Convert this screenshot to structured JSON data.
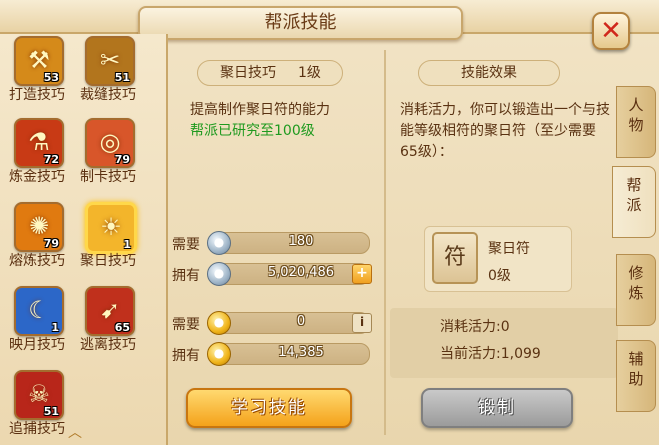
{
  "window": {
    "title": "帮派技能"
  },
  "skills": [
    {
      "name": "打造技巧",
      "level": "53",
      "color": "#d58a1a",
      "glyph": "⚒"
    },
    {
      "name": "裁缝技巧",
      "level": "51",
      "color": "#b2751d",
      "glyph": "✂"
    },
    {
      "name": "炼金技巧",
      "level": "72",
      "color": "#c83a15",
      "glyph": "⚗"
    },
    {
      "name": "制卡技巧",
      "level": "79",
      "color": "#d8562a",
      "glyph": "◎"
    },
    {
      "name": "熔炼技巧",
      "level": "79",
      "color": "#e07a10",
      "glyph": "✺"
    },
    {
      "name": "聚日技巧",
      "level": "1",
      "color": "#f3b52b",
      "glyph": "☀",
      "selected": true
    },
    {
      "name": "映月技巧",
      "level": "1",
      "color": "#2c67c8",
      "glyph": "☾"
    },
    {
      "name": "逃离技巧",
      "level": "65",
      "color": "#c0301c",
      "glyph": "➹"
    },
    {
      "name": "追捕技巧",
      "level": "51",
      "color": "#b8261a",
      "glyph": "☠"
    }
  ],
  "detail": {
    "skill_name": "聚日技巧",
    "skill_level": "1级",
    "desc": "提高制作聚日符的能力",
    "guild_status": "帮派已研究至100级",
    "need_label": "需要",
    "have_label": "拥有",
    "silver_need": "180",
    "silver_have": "5,020,486",
    "gold_need": "0",
    "gold_have": "14,385",
    "learn_button": "学习技能"
  },
  "effect": {
    "tab_title": "技能效果",
    "description": "消耗活力，你可以锻造出一个与技能等级相符的聚日符（至少需要65级）：",
    "item_name": "聚日符",
    "item_level": "0级",
    "energy_cost": "消耗活力:0",
    "energy_current": "当前活力:1,099",
    "forge_button": "锻制"
  },
  "side_tabs": [
    {
      "label": "人物",
      "active": false
    },
    {
      "label": "帮派",
      "active": true
    },
    {
      "label": "修炼",
      "active": false
    },
    {
      "label": "辅助",
      "active": false
    }
  ]
}
